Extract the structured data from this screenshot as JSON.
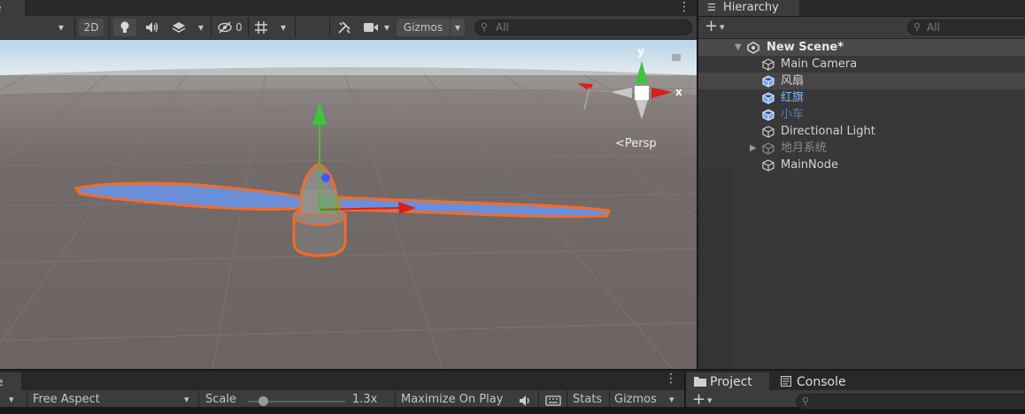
{
  "scene": {
    "tab_label": "e",
    "toolbar": {
      "mode_2d": "2D",
      "hidden_count": "0",
      "gizmos_label": "Gizmos",
      "search_placeholder": "All"
    },
    "gizmo": {
      "axis_y": "y",
      "axis_x": "x",
      "projection": "Persp"
    }
  },
  "hierarchy": {
    "tab_label": "Hierarchy",
    "search_placeholder": "All",
    "scene_name": "New Scene*",
    "items": [
      {
        "label": "Main Camera",
        "color": "#d2d2d2",
        "icon": "gameobject-icon"
      },
      {
        "label": "风扇",
        "color": "#d2d2d2",
        "icon": "prefab-icon"
      },
      {
        "label": "红旗",
        "color": "#7bb6ff",
        "icon": "prefab-icon"
      },
      {
        "label": "小车",
        "color": "#5b7fb0",
        "icon": "prefab-icon"
      },
      {
        "label": "Directional Light",
        "color": "#d2d2d2",
        "icon": "gameobject-icon"
      },
      {
        "label": "地月系统",
        "color": "#8a8a8a",
        "icon": "gameobject-icon"
      },
      {
        "label": "MainNode",
        "color": "#d2d2d2",
        "icon": "gameobject-icon"
      }
    ]
  },
  "game": {
    "tab_label": "e",
    "aspect": "Free Aspect",
    "scale_label": "Scale",
    "scale_value": "1.3x",
    "scale_slider_fraction": 0.15,
    "maximize_label": "Maximize On Play",
    "stats_label": "Stats",
    "gizmos_label": "Gizmos"
  },
  "project": {
    "tab_project": "Project",
    "tab_console": "Console"
  },
  "colors": {
    "selection_outline": "#f26b2a",
    "blade_fill": "#6a8fd8",
    "axis_y": "#3cc43c",
    "axis_x": "#d42020"
  }
}
